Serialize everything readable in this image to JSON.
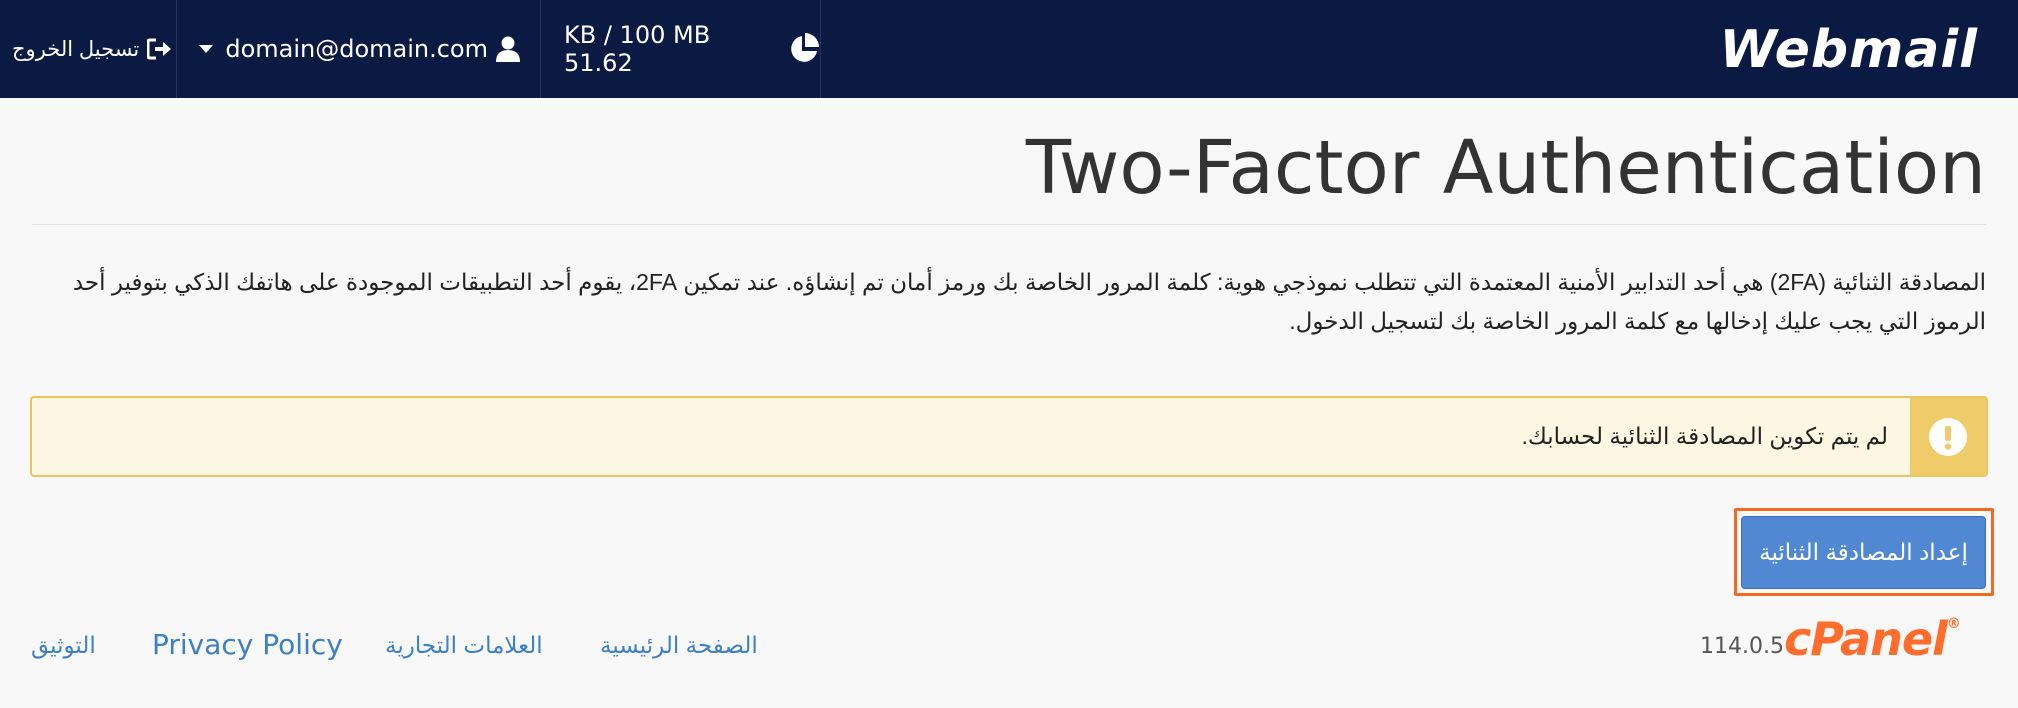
{
  "header": {
    "logo_text": "Webmail",
    "logout_label": "تسجيل الخروج",
    "user_email": "domain@domain.com",
    "quota_text": "KB / 100 MB 51.62"
  },
  "page": {
    "title": "Two-Factor Authentication",
    "description": "المصادقة الثنائية (2FA) هي أحد التدابير الأمنية المعتمدة التي تتطلب نموذجي هوية: كلمة المرور الخاصة بك ورمز أمان تم إنشاؤه. عند تمكين 2FA، يقوم أحد التطبيقات الموجودة على هاتفك الذكي بتوفير أحد الرموز التي يجب عليك إدخالها مع كلمة المرور الخاصة بك لتسجيل الدخول.",
    "alert_text": "لم يتم تكوين المصادقة الثنائية لحسابك.",
    "setup_button_label": "إعداد المصادقة الثنائية"
  },
  "footer": {
    "cpanel_logo_text": "cPanel",
    "cpanel_version": "114.0.5",
    "links": {
      "home": "الصفحة الرئيسية",
      "trademarks": "العلامات التجارية",
      "privacy": "Privacy Policy",
      "documentation": "التوثيق"
    }
  },
  "colors": {
    "topbar": "#0b1a42",
    "link": "#3d80c4",
    "button": "#5188d3",
    "highlight": "#f26a22",
    "alert_bg": "#fcf8e3",
    "alert_icon_bg": "#efcb6a",
    "cpanel_orange": "#ff6c2c"
  },
  "icons": {
    "logout": "sign-out-icon",
    "user": "user-icon",
    "dropdown": "caret-down-icon",
    "quota": "pie-chart-icon",
    "alert": "exclamation-icon"
  }
}
